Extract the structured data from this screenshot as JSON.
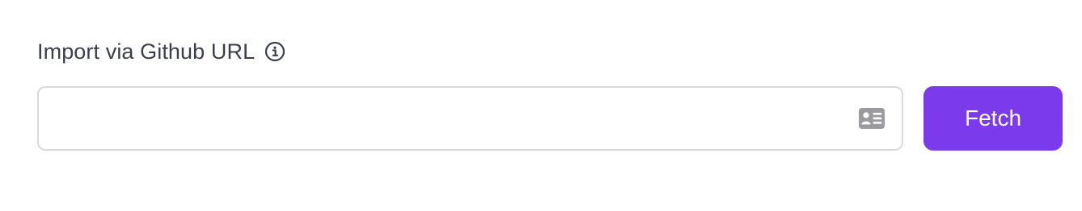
{
  "import_section": {
    "label": "Import via Github URL",
    "info_icon": "info-circle-icon",
    "input": {
      "value": "",
      "placeholder": "",
      "trailing_icon": "contact-card-icon"
    },
    "fetch_label": "Fetch"
  },
  "colors": {
    "accent": "#7c3aed",
    "label_text": "#3a3f4b",
    "input_border": "#d9d9dc",
    "icon_gray": "#9a9a9f"
  }
}
